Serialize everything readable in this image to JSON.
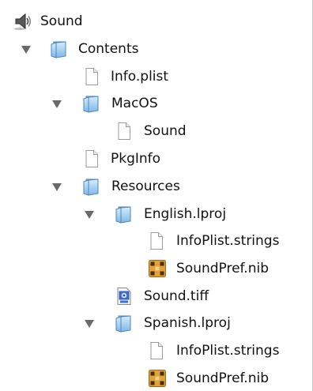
{
  "tree": {
    "root_label": "Sound",
    "contents_label": "Contents",
    "info_plist_label": "Info.plist",
    "macos_label": "MacOS",
    "macos_sound_label": "Sound",
    "pkginfo_label": "PkgInfo",
    "resources_label": "Resources",
    "english_lproj_label": "English.lproj",
    "english_infoplist_strings_label": "InfoPlist.strings",
    "english_soundpref_nib_label": "SoundPref.nib",
    "sound_tiff_label": "Sound.tiff",
    "spanish_lproj_label": "Spanish.lproj",
    "spanish_infoplist_strings_label": "InfoPlist.strings",
    "spanish_soundpref_nib_label": "SoundPref.nib"
  }
}
